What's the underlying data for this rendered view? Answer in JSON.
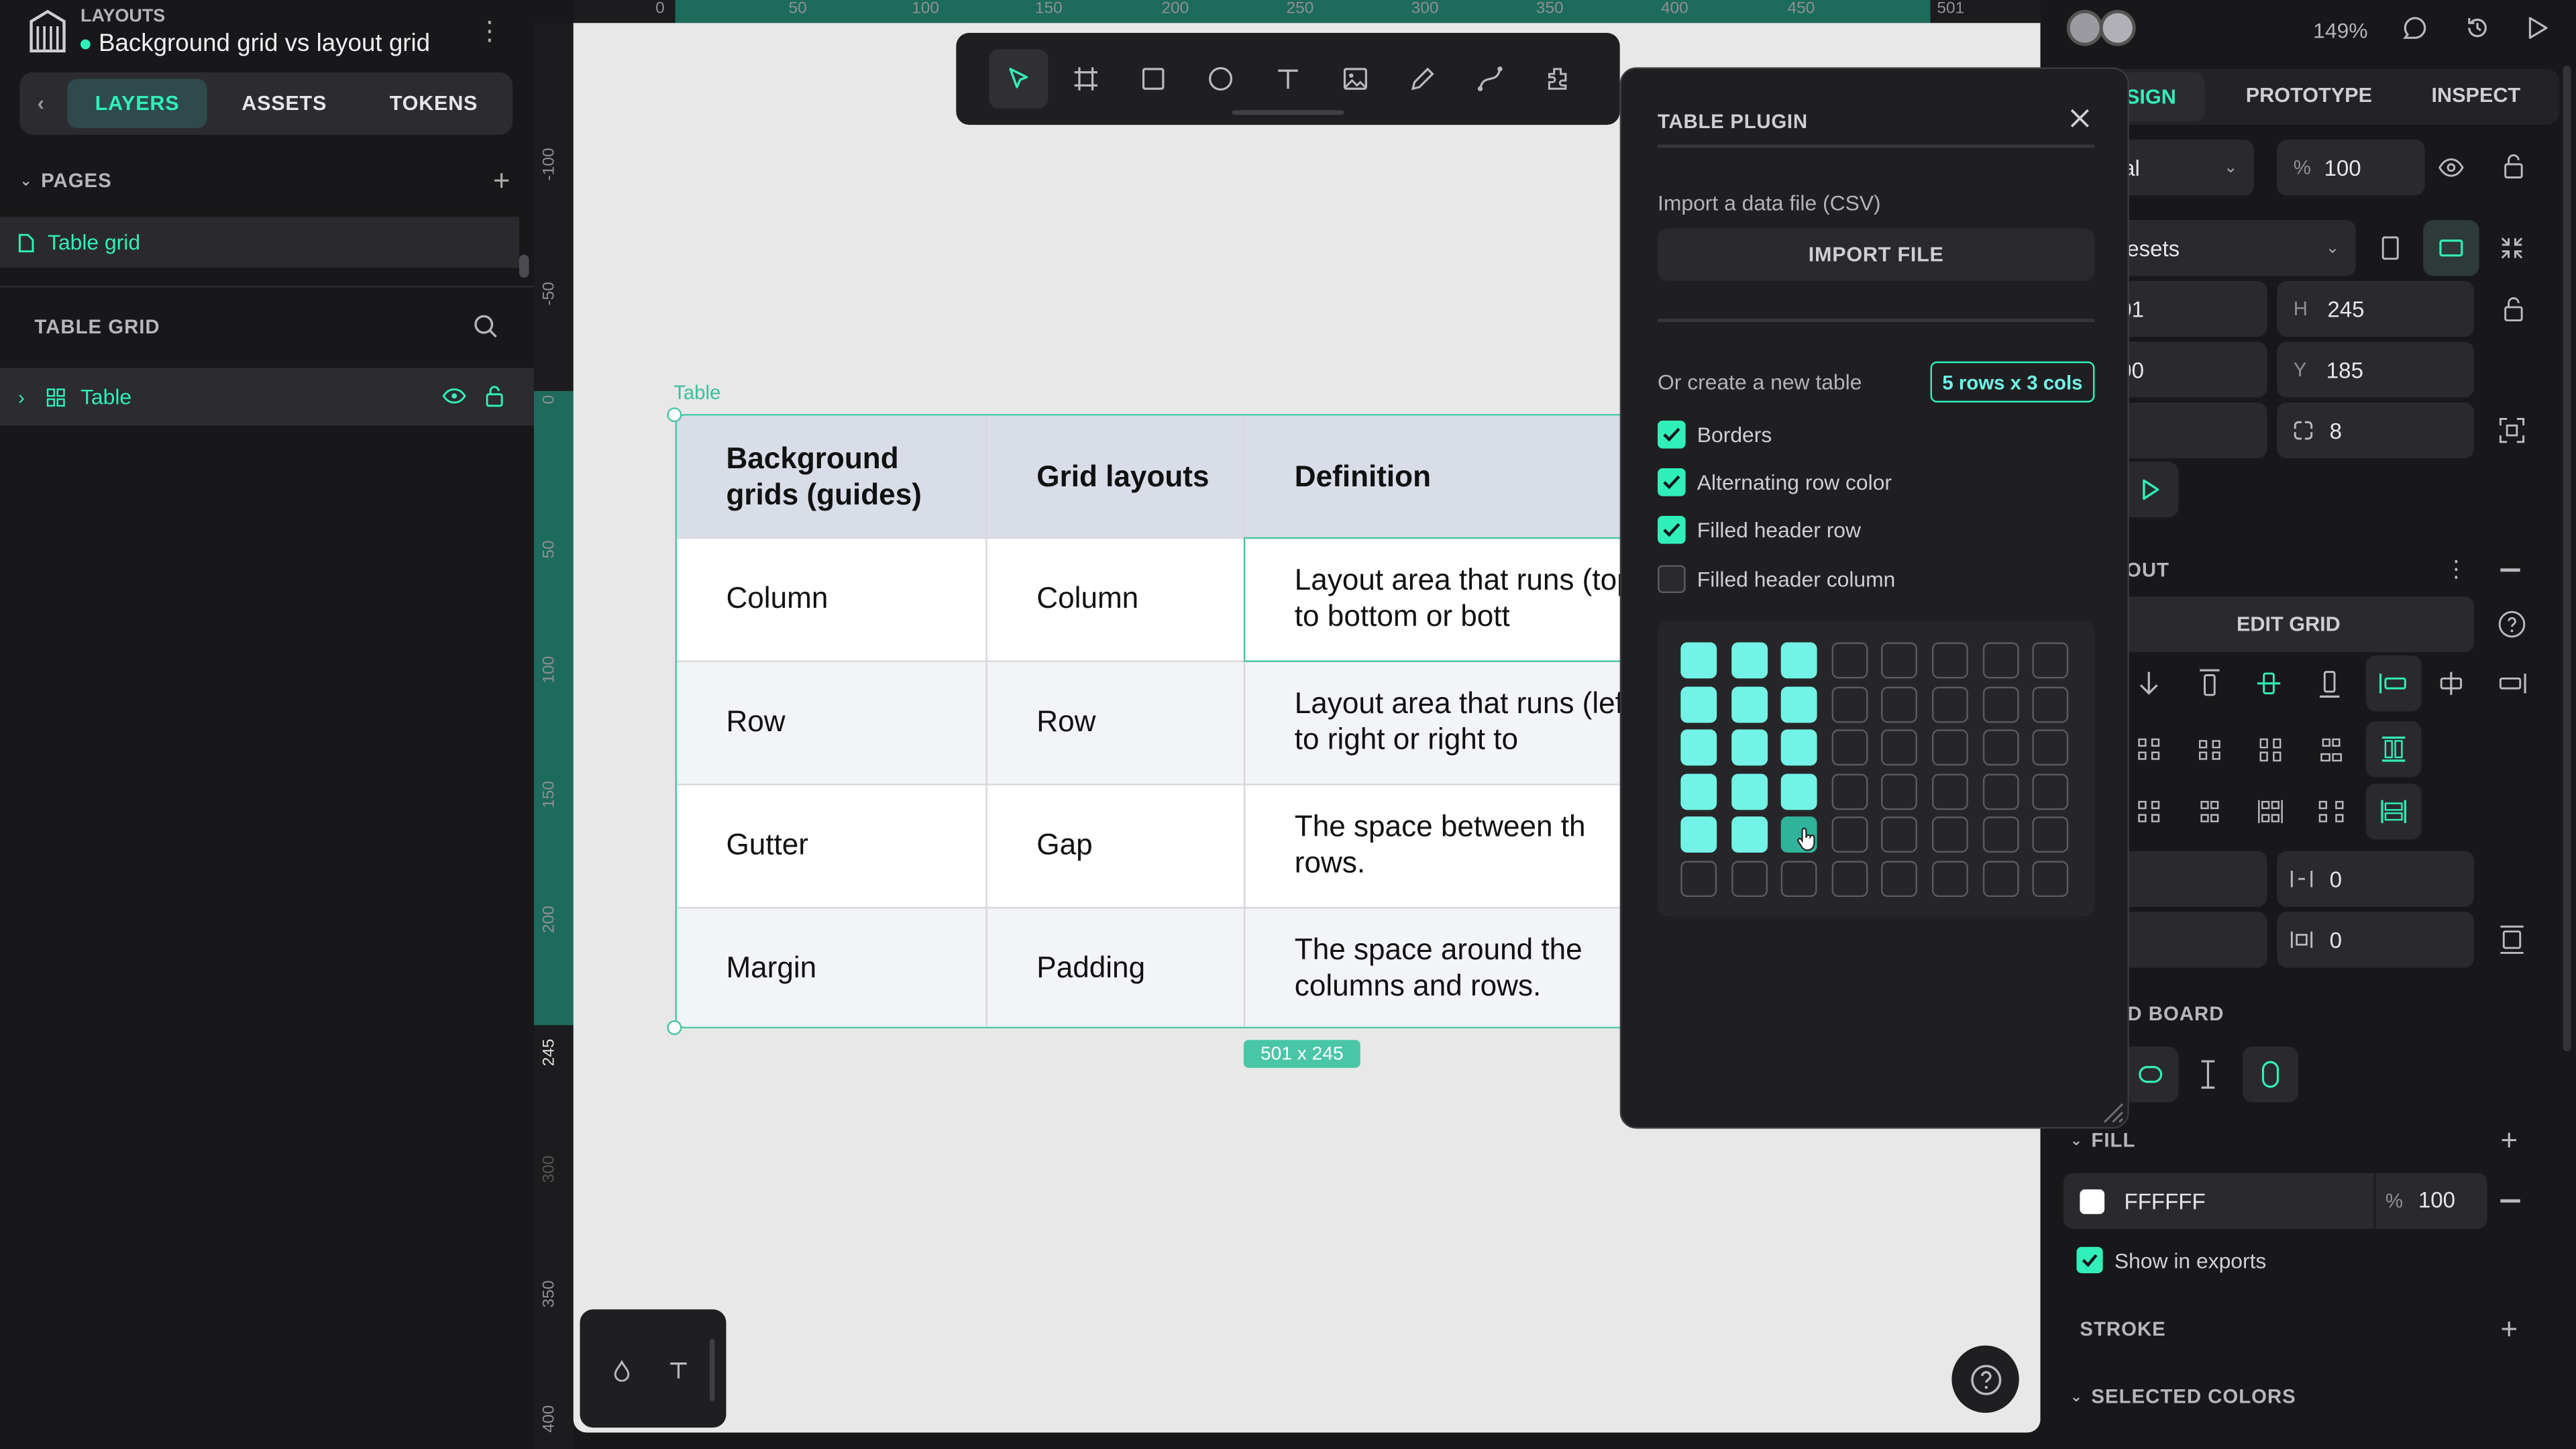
{
  "app": {
    "project_label": "LAYOUTS",
    "file_title": "Background grid vs layout grid",
    "zoom": "149%"
  },
  "left_panel": {
    "tabs": [
      "LAYERS",
      "ASSETS",
      "TOKENS"
    ],
    "pages_header": "PAGES",
    "pages": [
      "Table grid"
    ],
    "board_header": "TABLE GRID",
    "layers": [
      "Table"
    ]
  },
  "rulers": {
    "top": [
      "0",
      "50",
      "100",
      "150",
      "200",
      "250",
      "300",
      "350",
      "400",
      "450",
      "501"
    ],
    "left": [
      "-100",
      "-50",
      "0",
      "50",
      "100",
      "150",
      "200",
      "245",
      "300",
      "350",
      "400"
    ]
  },
  "canvas": {
    "board_label": "Table",
    "size_badge": "501 x 245",
    "table": {
      "headers": [
        "Background grids (guides)",
        "Grid layouts",
        "Definition"
      ],
      "rows": [
        [
          "Column",
          "Column",
          "Layout area that runs (top to bottom or bott"
        ],
        [
          "Row",
          "Row",
          "Layout area that runs (left to right or right to"
        ],
        [
          "Gutter",
          "Gap",
          "The space between th rows."
        ],
        [
          "Margin",
          "Padding",
          "The space around the columns and rows."
        ]
      ]
    },
    "bottom_tools": [
      "drop-icon",
      "text-icon"
    ]
  },
  "toolbar": {
    "tools": [
      "pointer-icon",
      "board-icon",
      "rectangle-icon",
      "ellipse-icon",
      "text-icon",
      "image-icon",
      "pencil-icon",
      "path-icon",
      "plugins-icon"
    ]
  },
  "plugin": {
    "title": "TABLE PLUGIN",
    "import_label": "Import a data file (CSV)",
    "import_button": "IMPORT FILE",
    "create_label": "Or create a new table",
    "size_chip": "5 rows x 3 cols",
    "options": [
      {
        "label": "Borders",
        "checked": true
      },
      {
        "label": "Alternating row color",
        "checked": true
      },
      {
        "label": "Filled header row",
        "checked": true
      },
      {
        "label": "Filled header column",
        "checked": false
      }
    ],
    "grid": {
      "rows": 6,
      "cols": 8,
      "selected_rows": 5,
      "selected_cols": 3
    }
  },
  "right_panel": {
    "tabs": [
      "SIGN",
      "PROTOTYPE",
      "INSPECT"
    ],
    "layer_opacity": "100",
    "preset_partial": "al",
    "presets_label": "resets",
    "w_value": "01",
    "h_label": "H",
    "h_value": "245",
    "x_value": "00",
    "y_label": "Y",
    "y_value": "185",
    "radius_value": "8",
    "layout_header": "OUT",
    "edit_grid": "EDIT GRID",
    "gap_col": "0",
    "gap_row": "0",
    "board_header": "D BOARD",
    "fill_header": "FILL",
    "fill_hex": "FFFFFF",
    "fill_opacity": "100",
    "show_in_exports": "Show in exports",
    "stroke_header": "STROKE",
    "selected_colors_header": "SELECTED COLORS",
    "percent_sign": "%"
  },
  "colors": {
    "accent": "#31efb8",
    "grid_selected": "#72f3e6"
  }
}
